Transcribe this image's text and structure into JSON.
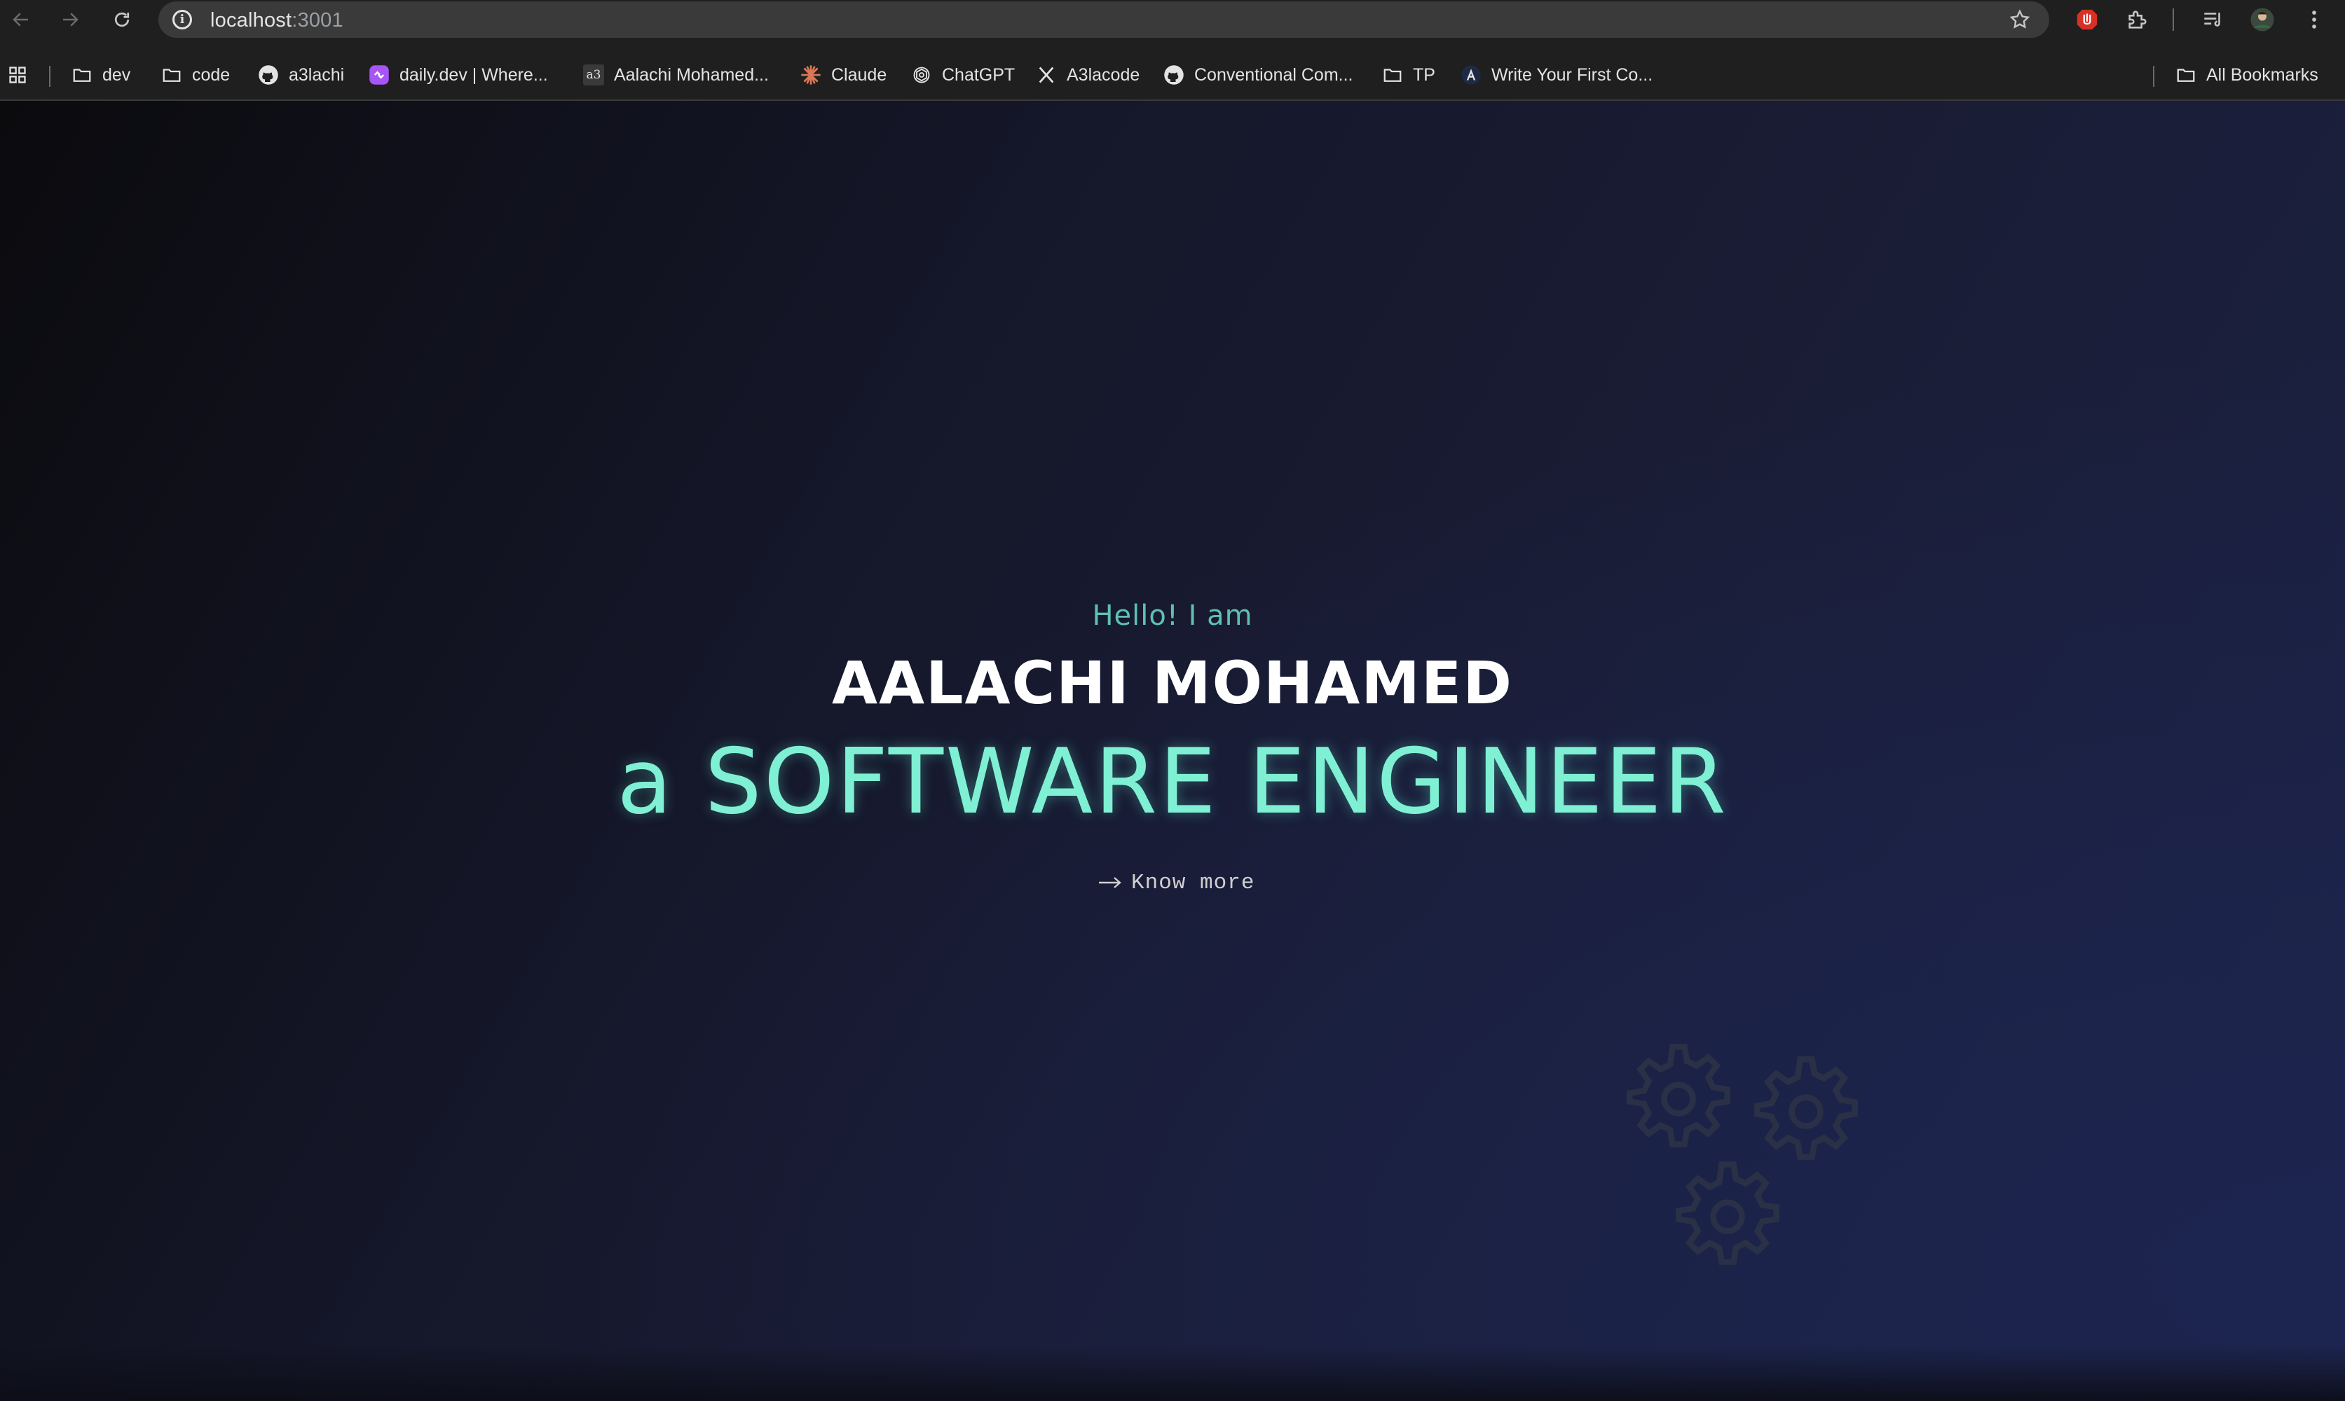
{
  "browser": {
    "url_host": "localhost",
    "url_port": ":3001",
    "bookmarks": [
      {
        "label": "dev",
        "icon": "folder-icon"
      },
      {
        "label": "code",
        "icon": "folder-icon"
      },
      {
        "label": "a3lachi",
        "icon": "github-icon"
      },
      {
        "label": "daily.dev | Where...",
        "icon": "dailydev-icon"
      },
      {
        "label": "Aalachi Mohamed...",
        "icon": "a3-icon"
      },
      {
        "label": "Claude",
        "icon": "claude-icon"
      },
      {
        "label": "ChatGPT",
        "icon": "chatgpt-icon"
      },
      {
        "label": "A3lacode",
        "icon": "x-icon"
      },
      {
        "label": "Conventional Com...",
        "icon": "github-icon"
      },
      {
        "label": "TP",
        "icon": "folder-icon"
      },
      {
        "label": "Write Your First Co...",
        "icon": "angular-icon"
      }
    ],
    "all_bookmarks": "All Bookmarks",
    "a3_badge": "a3"
  },
  "hero": {
    "greeting": "Hello! I am",
    "name": "AALACHI MOHAMED",
    "role": "a SOFTWARE ENGINEER",
    "cta_label": "Know more"
  },
  "colors": {
    "accent": "#7ff0d3",
    "greeting": "#5fc1b0",
    "background_dark": "#0b0b0e",
    "background_navy": "#1b2246"
  }
}
